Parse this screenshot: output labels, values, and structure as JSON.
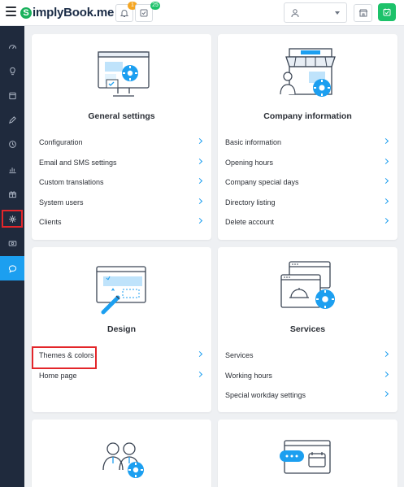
{
  "header": {
    "logo_text": "implyBook.me",
    "logo_initial": "S",
    "notifications_count": "1",
    "tasks_count": "25"
  },
  "sidebar": {
    "items": [
      {
        "icon": "dashboard-icon"
      },
      {
        "icon": "lightbulb-icon"
      },
      {
        "icon": "calendar-icon"
      },
      {
        "icon": "pencil-icon"
      },
      {
        "icon": "clock-icon"
      },
      {
        "icon": "reports-chart-icon"
      },
      {
        "icon": "gift-icon"
      },
      {
        "icon": "settings-gear-icon",
        "selected": true
      },
      {
        "icon": "money-icon"
      },
      {
        "icon": "chat-icon",
        "active": true
      }
    ]
  },
  "cards": {
    "general": {
      "title": "General settings",
      "links": [
        "Configuration",
        "Email and SMS settings",
        "Custom translations",
        "System users",
        "Clients"
      ]
    },
    "company": {
      "title": "Company information",
      "links": [
        "Basic information",
        "Opening hours",
        "Company special days",
        "Directory listing",
        "Delete account"
      ]
    },
    "design": {
      "title": "Design",
      "links": [
        "Themes & colors",
        "Home page"
      ]
    },
    "services": {
      "title": "Services",
      "links": [
        "Services",
        "Working hours",
        "Special workday settings"
      ]
    }
  },
  "colors": {
    "accent": "#1c9ff0",
    "brand_green": "#19b15c",
    "sidebar_bg": "#1f2a3d",
    "highlight_red": "#e3262a",
    "badge_orange": "#f5a623",
    "badge_green": "#1dc26a"
  }
}
